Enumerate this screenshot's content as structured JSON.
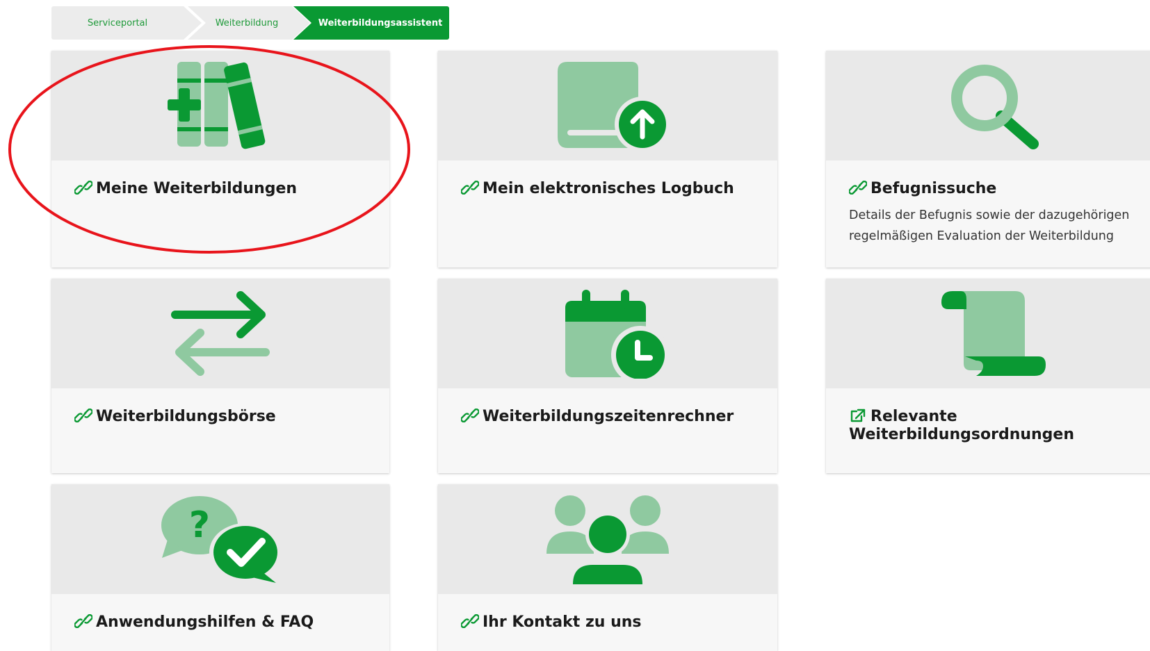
{
  "breadcrumb": {
    "items": [
      "Serviceportal",
      "Weiterbildung",
      "Weiterbildungsassistent"
    ]
  },
  "colors": {
    "accent": "#0a9933",
    "accent_light": "#8fc9a0",
    "annotation": "#e8141b"
  },
  "tiles": [
    {
      "title": "Meine Weiterbildungen",
      "icon": "books-plus-icon",
      "link": "link-icon"
    },
    {
      "title": "Mein elektronisches Logbuch",
      "icon": "book-upload-icon",
      "link": "link-icon"
    },
    {
      "title": "Befugnissuche",
      "icon": "magnifier-icon",
      "link": "link-icon",
      "description": "Details der Befugnis sowie der dazugehörigen regelmäßigen Evaluation der Weiterbildung"
    },
    {
      "title": "Weiterbildungsbörse",
      "icon": "exchange-arrows-icon",
      "link": "link-icon"
    },
    {
      "title": "Weiterbildungszeitenrechner",
      "icon": "calendar-clock-icon",
      "link": "link-icon"
    },
    {
      "title": "Relevante Weiterbildungsordnungen",
      "icon": "scroll-icon",
      "link": "external-link-icon"
    },
    {
      "title": "Anwendungshilfen & FAQ",
      "icon": "chat-question-check-icon",
      "link": "link-icon"
    },
    {
      "title": "Ihr Kontakt zu uns",
      "icon": "people-group-icon",
      "link": "link-icon"
    }
  ]
}
